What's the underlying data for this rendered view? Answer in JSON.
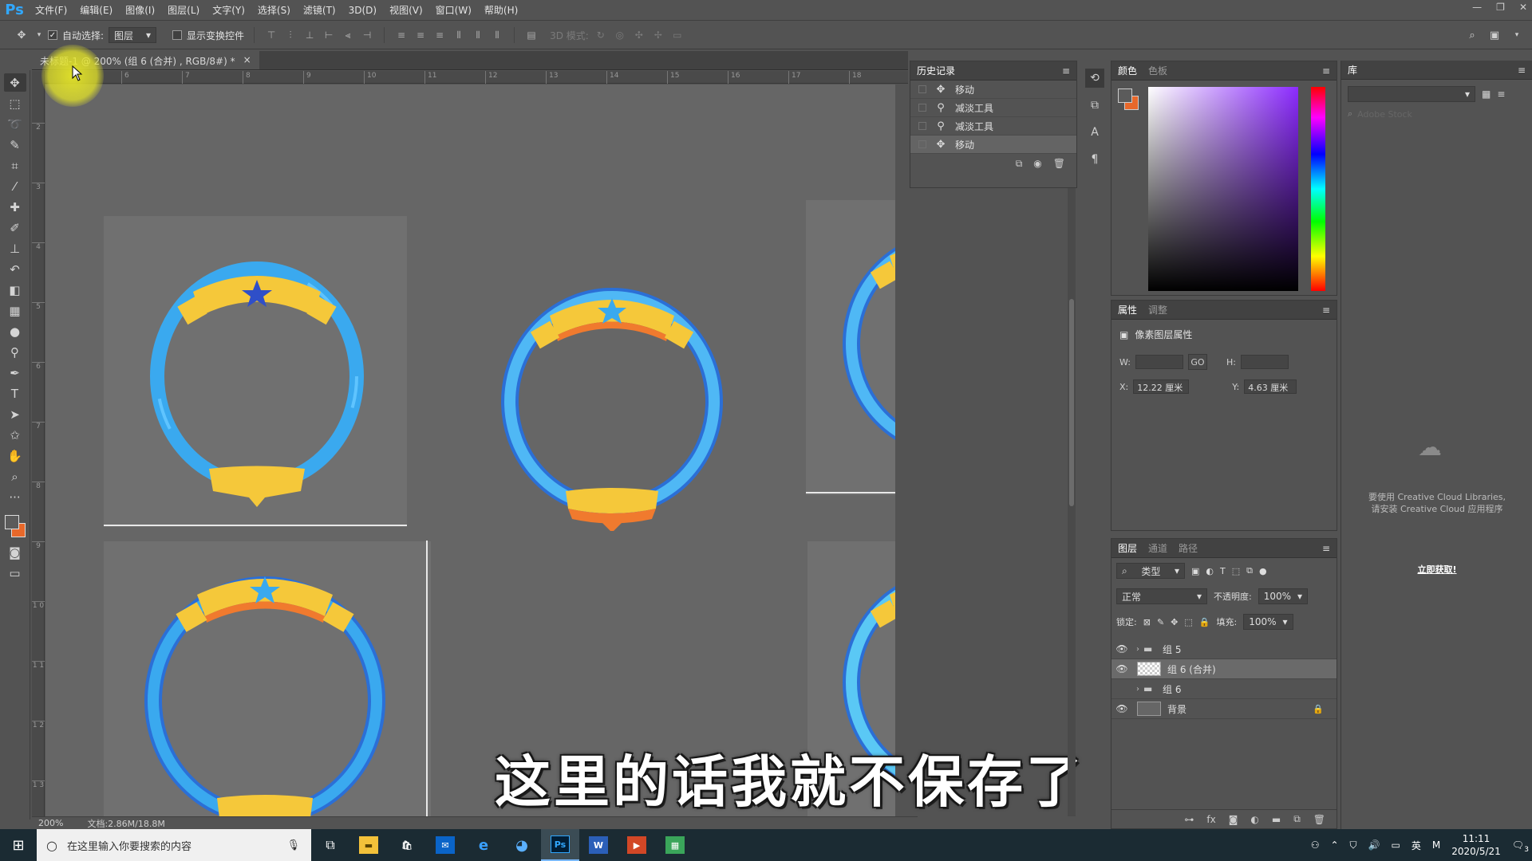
{
  "app": {
    "logo": "Ps",
    "menu": [
      "文件(F)",
      "编辑(E)",
      "图像(I)",
      "图层(L)",
      "文字(Y)",
      "选择(S)",
      "滤镜(T)",
      "3D(D)",
      "视图(V)",
      "窗口(W)",
      "帮助(H)"
    ],
    "window_controls": [
      "—",
      "❐",
      "✕"
    ]
  },
  "options_bar": {
    "auto_select_label": "自动选择:",
    "auto_select_checked": true,
    "auto_select_target": "图层",
    "show_transform_label": "显示变换控件",
    "mode_3d_label": "3D 模式:"
  },
  "document": {
    "tab_title": "未标题-1 @ 200% (组 6 (合并) , RGB/8#) *",
    "close": "×",
    "ruler_h": [
      "6",
      "7",
      "8",
      "9",
      "10",
      "11",
      "12",
      "13",
      "14",
      "15",
      "16",
      "17",
      "18"
    ],
    "ruler_v": [
      "2",
      "3",
      "4",
      "5",
      "6",
      "7",
      "8",
      "9",
      "1 0",
      "1 1",
      "1 2",
      "1 3"
    ]
  },
  "subtitle": "这里的话我就不保存了",
  "status_bar": {
    "zoom": "200%",
    "doc_info": "文档:2.86M/18.8M"
  },
  "history_panel": {
    "title": "历史记录",
    "items": [
      {
        "label": "移动",
        "icon": "move-icon"
      },
      {
        "label": "减淡工具",
        "icon": "dodge-icon"
      },
      {
        "label": "减淡工具",
        "icon": "dodge-icon"
      },
      {
        "label": "移动",
        "icon": "move-icon"
      }
    ],
    "selected_index": 3
  },
  "color_panel": {
    "tabs": [
      "颜色",
      "色板"
    ],
    "foreground": "#5b5b5b",
    "background": "#e8682a"
  },
  "properties_panel": {
    "tabs": [
      "属性",
      "调整"
    ],
    "section_title": "像素图层属性",
    "w_label": "W:",
    "h_label": "H:",
    "x_label": "X:",
    "x_value": "12.22 厘米",
    "y_label": "Y:",
    "y_value": "4.63 厘米",
    "link_label": "GO"
  },
  "layers_panel": {
    "tabs": [
      "图层",
      "通道",
      "路径"
    ],
    "filter_label": "类型",
    "blend_mode": "正常",
    "opacity_label": "不透明度:",
    "opacity_value": "100%",
    "lock_label": "锁定:",
    "fill_label": "填充:",
    "fill_value": "100%",
    "layers": [
      {
        "name": "组 5",
        "type": "group",
        "visible": true
      },
      {
        "name": "组 6 (合并)",
        "type": "pixel",
        "visible": true,
        "selected": true
      },
      {
        "name": "组 6",
        "type": "group",
        "visible": false
      },
      {
        "name": "背景",
        "type": "background",
        "visible": true,
        "locked": true
      }
    ]
  },
  "library_panel": {
    "title": "库",
    "search_placeholder": "Adobe Stock",
    "message_line1": "要使用 Creative Cloud Libraries,",
    "message_line2": "请安装 Creative Cloud 应用程序",
    "link": "立即获取!"
  },
  "taskbar": {
    "search_placeholder": "在这里输入你要搜索的内容",
    "time": "11:11",
    "date": "2020/5/21",
    "ime": "英",
    "notification_count": "3"
  },
  "colors": {
    "ring_blue": "#3aa9ef",
    "ring_blue_dark": "#2b6fd6",
    "ring_yellow": "#f5c83a",
    "ring_orange": "#f07a2e",
    "star_blue": "#2f4fc8"
  }
}
